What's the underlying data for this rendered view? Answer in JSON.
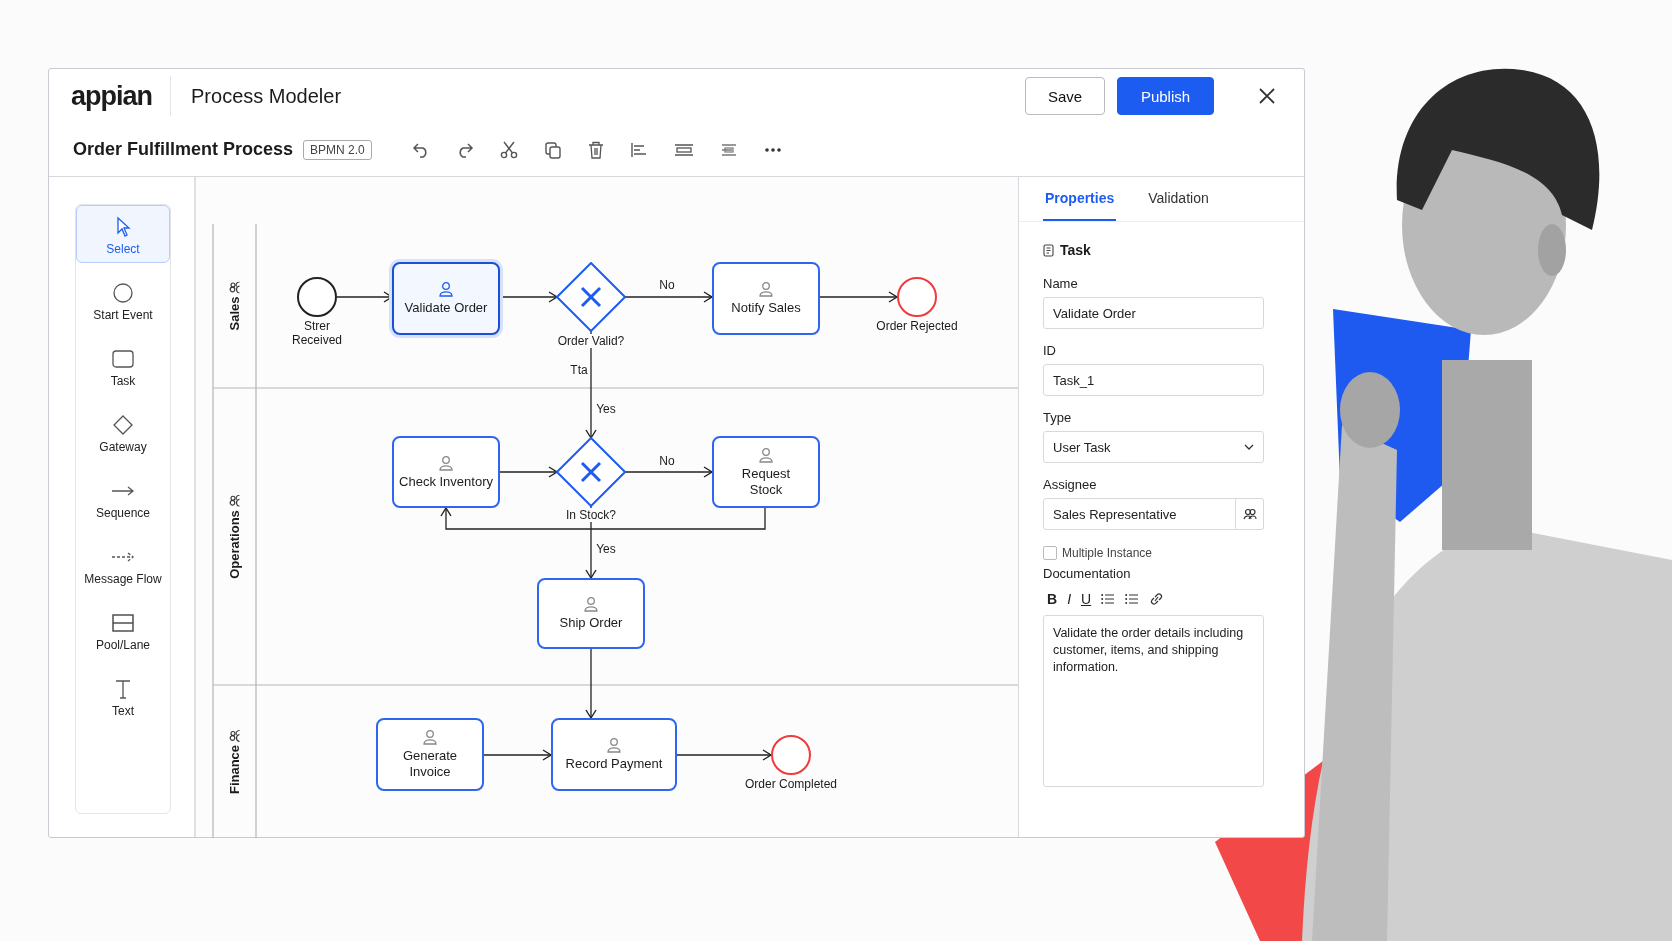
{
  "window": {
    "logo": "appian",
    "title": "Process Modeler",
    "buttons": [
      {
        "label": "Save",
        "kind": "secondary"
      },
      {
        "label": "Publish",
        "kind": "primary"
      }
    ]
  },
  "process": {
    "name": "Order Fulfillment Process",
    "badge": "BPMN 2.0"
  },
  "palette": [
    {
      "label": "Select",
      "kind": "pointer",
      "selected": true
    },
    {
      "label": "Start Event",
      "kind": "circle",
      "selected": false
    },
    {
      "label": "Task",
      "kind": "rect",
      "selected": false
    },
    {
      "label": "Gateway",
      "kind": "diamond",
      "selected": false
    },
    {
      "label": "Sequence",
      "kind": "arrow",
      "selected": false
    },
    {
      "label": "Message Flow",
      "kind": "dashed-arrow",
      "selected": false
    },
    {
      "label": "Pool/Lane",
      "kind": "pool",
      "selected": false
    },
    {
      "label": "Text",
      "kind": "text",
      "selected": false
    }
  ],
  "diagram": {
    "lanes": [
      {
        "name": "Sales"
      },
      {
        "name": "Operations"
      },
      {
        "name": "Finance"
      }
    ],
    "nodes": [
      {
        "kind": "start",
        "label": "Strer\nReceived",
        "selected": false
      },
      {
        "kind": "task",
        "label": "Validate Order",
        "selected": true
      },
      {
        "kind": "gateway",
        "label": "Order Valid?",
        "selected": false
      },
      {
        "kind": "task",
        "label": "Notify Sales",
        "selected": false
      },
      {
        "kind": "end",
        "label": "Order Rejected",
        "selected": false
      },
      {
        "kind": "task",
        "label": "Check Inventory",
        "selected": false
      },
      {
        "kind": "gateway",
        "label": "In Stock?",
        "selected": false
      },
      {
        "kind": "task",
        "label": "Request\nStock",
        "selected": false
      },
      {
        "kind": "task",
        "label": "Ship Order",
        "selected": false
      },
      {
        "kind": "task",
        "label": "Generate\nInvoice",
        "selected": false
      },
      {
        "kind": "task",
        "label": "Record Payment",
        "selected": false
      },
      {
        "kind": "end",
        "label": "Order Completed",
        "selected": false
      }
    ],
    "flow_labels": [
      "No",
      "Tta",
      "Yes",
      "No",
      "Yes"
    ]
  },
  "panel": {
    "tabs": [
      {
        "label": "Properties",
        "selected": true
      },
      {
        "label": "Validation",
        "selected": false
      }
    ],
    "heading": "Task",
    "fields": [
      {
        "label": "Name",
        "value": "Validate Order",
        "kind": "text"
      },
      {
        "label": "ID",
        "value": "Task_1",
        "kind": "text"
      },
      {
        "label": "Type",
        "value": "User Task",
        "kind": "select"
      },
      {
        "label": "Assignee",
        "value": "Sales Representative",
        "kind": "picker"
      }
    ],
    "checkbox": {
      "label": "Multiple Instance",
      "checked": false
    },
    "documentation": {
      "label": "Documentation",
      "format_buttons": [
        "B",
        "I",
        "U"
      ],
      "text": "Validate the order details including customer, items, and shipping information."
    }
  }
}
